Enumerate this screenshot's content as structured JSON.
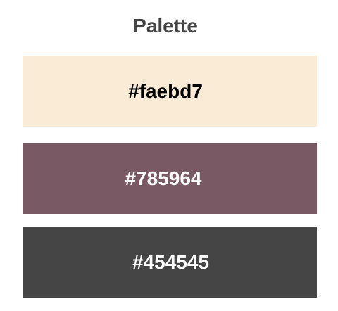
{
  "title": "Palette",
  "swatches": [
    {
      "label": "#faebd7",
      "color": "#faebd7",
      "text_color": "#000000"
    },
    {
      "label": "#785964",
      "color": "#785964",
      "text_color": "#ffffff"
    },
    {
      "label": "#454545",
      "color": "#454545",
      "text_color": "#ffffff"
    }
  ]
}
